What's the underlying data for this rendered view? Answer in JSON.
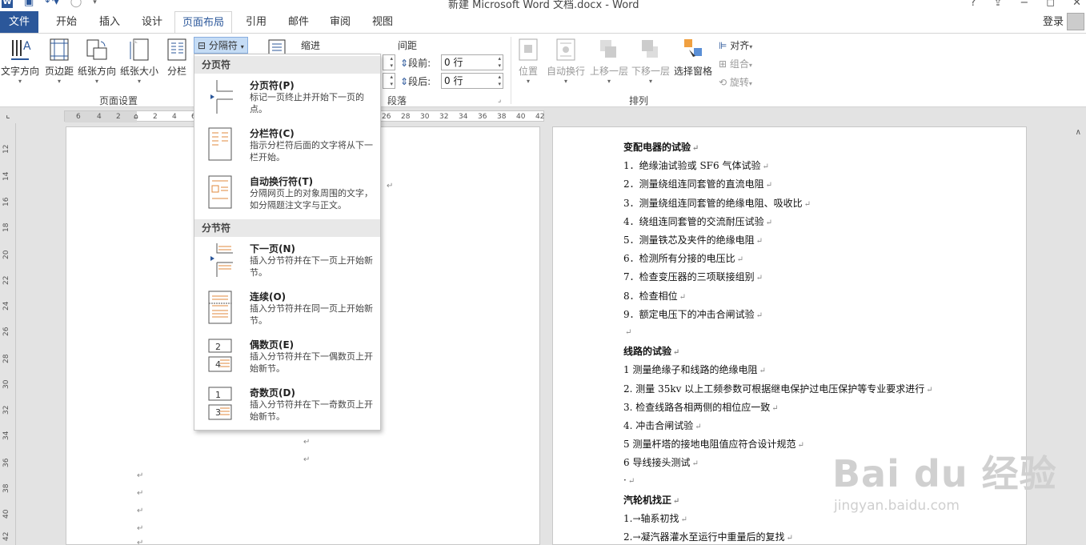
{
  "window": {
    "title": "新建 Microsoft Word 文档.docx - Word",
    "controls": [
      "?",
      "⇪",
      "−",
      "◻",
      "✕"
    ]
  },
  "tabs": [
    {
      "label": "文件"
    },
    {
      "label": "开始"
    },
    {
      "label": "插入"
    },
    {
      "label": "设计"
    },
    {
      "label": "页面布局"
    },
    {
      "label": "引用"
    },
    {
      "label": "邮件"
    },
    {
      "label": "审阅"
    },
    {
      "label": "视图"
    }
  ],
  "account": {
    "login": "登录"
  },
  "ribbon": {
    "page_setup": {
      "label": "页面设置",
      "buttons": [
        "文字方向",
        "页边距",
        "纸张方向",
        "纸张大小",
        "分栏"
      ],
      "breaks_button": "分隔符"
    },
    "paragraph": {
      "label": "段落",
      "indent_label": "缩进",
      "spacing_label": "间距",
      "before_label": "段前:",
      "before_value": "0 行",
      "after_label": "段后:",
      "after_value": "0 行"
    },
    "arrange": {
      "label": "排列",
      "buttons": [
        "位置",
        "自动换行",
        "上移一层",
        "下移一层",
        "选择窗格"
      ],
      "align": "对齐",
      "group": "组合",
      "rotate": "旋转"
    }
  },
  "ruler": {
    "numbers": [
      "6",
      "4",
      "2",
      "2",
      "4",
      "6",
      "26",
      "28",
      "30",
      "32",
      "34",
      "36",
      "38",
      "40",
      "42"
    ],
    "vertical": [
      "12",
      "14",
      "16",
      "18",
      "20",
      "22",
      "24",
      "26",
      "28",
      "30",
      "32",
      "34",
      "36",
      "38",
      "40",
      "42"
    ]
  },
  "dropdown": {
    "page_breaks_header": "分页符",
    "section_breaks_header": "分节符",
    "items": [
      {
        "title": "分页符(P)",
        "desc": "标记一页终止并开始下一页的点。"
      },
      {
        "title": "分栏符(C)",
        "desc": "指示分栏符后面的文字将从下一栏开始。"
      },
      {
        "title": "自动换行符(T)",
        "desc": "分隔网页上的对象周围的文字，如分隔题注文字与正文。"
      },
      {
        "title": "下一页(N)",
        "desc": "插入分节符并在下一页上开始新节。"
      },
      {
        "title": "连续(O)",
        "desc": "插入分节符并在同一页上开始新节。"
      },
      {
        "title": "偶数页(E)",
        "desc": "插入分节符并在下一偶数页上开始新节。"
      },
      {
        "title": "奇数页(D)",
        "desc": "插入分节符并在下一奇数页上开始新节。"
      }
    ]
  },
  "page2_lines": [
    {
      "text": "变配电器的试验",
      "bold": true
    },
    {
      "text": "1．绝缘油试验或 SF6 气体试验",
      "bold": false
    },
    {
      "text": "2．测量绕组连同套管的直流电阻",
      "bold": false
    },
    {
      "text": "3．测量绕组连同套管的绝缘电阻、吸收比",
      "bold": false
    },
    {
      "text": "4．绕组连同套管的交流耐压试验",
      "bold": false
    },
    {
      "text": "5．测量铁芯及夹件的绝缘电阻",
      "bold": false
    },
    {
      "text": "6．检测所有分接的电压比",
      "bold": false
    },
    {
      "text": "7．检查变压器的三项联接组别",
      "bold": false
    },
    {
      "text": "8．检查相位",
      "bold": false
    },
    {
      "text": "9．额定电压下的冲击合闸试验",
      "bold": false
    },
    {
      "text": "",
      "bold": false
    },
    {
      "text": "线路的试验",
      "bold": true
    },
    {
      "text": "1 测量绝缘子和线路的绝缘电阻",
      "bold": false
    },
    {
      "text": "2. 测量 35kv 以上工频参数可根据继电保护过电压保护等专业要求进行",
      "bold": false
    },
    {
      "text": "3. 检查线路各相两侧的相位应一致",
      "bold": false
    },
    {
      "text": "4. 冲击合闸试验",
      "bold": false
    },
    {
      "text": "5 测量杆塔的接地电阻值应符合设计规范",
      "bold": false
    },
    {
      "text": "6 导线接头测试",
      "bold": false
    },
    {
      "text": "·",
      "bold": false
    },
    {
      "text": "汽轮机找正",
      "bold": true
    },
    {
      "text": "1.→轴系初找",
      "bold": false
    },
    {
      "text": "2.→凝汽器灌水至运行中重量后的复找",
      "bold": false
    }
  ],
  "paragraph_mark": "↵",
  "watermark": {
    "main": "Bai du 经验",
    "sub": "jingyan.baidu.com"
  },
  "colors": {
    "accent": "#2b579a",
    "ribbon_bg": "#ffffff",
    "workspace": "#e3e3e3"
  }
}
